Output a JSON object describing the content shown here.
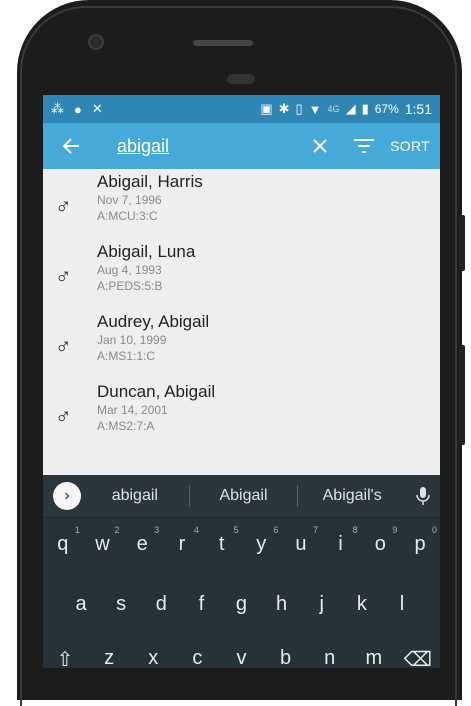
{
  "statusbar": {
    "battery": "67%",
    "time": "1:51",
    "network": "4G"
  },
  "toolbar": {
    "query": "abigail",
    "sort_label": "SORT"
  },
  "patients": [
    {
      "name": "Abigail, Harris",
      "dob": "Nov 7, 1996",
      "location": "A:MCU:3:C",
      "gender_icon": "♂"
    },
    {
      "name": "Abigail, Luna",
      "dob": "Aug 4, 1993",
      "location": "A:PEDS:5:B",
      "gender_icon": "♂"
    },
    {
      "name": "Audrey, Abigail",
      "dob": "Jan 10, 1999",
      "location": "A:MS1:1:C",
      "gender_icon": "♂"
    },
    {
      "name": "Duncan, Abigail",
      "dob": "Mar 14, 2001",
      "location": "A:MS2:7:A",
      "gender_icon": "♂"
    }
  ],
  "keyboard": {
    "suggestions": [
      "abigail",
      "Abigail",
      "Abigail's"
    ],
    "row1": [
      "q",
      "w",
      "e",
      "r",
      "t",
      "y",
      "u",
      "i",
      "o",
      "p"
    ],
    "row1_nums": [
      "1",
      "2",
      "3",
      "4",
      "5",
      "6",
      "7",
      "8",
      "9",
      "0"
    ],
    "row2": [
      "a",
      "s",
      "d",
      "f",
      "g",
      "h",
      "j",
      "k",
      "l"
    ],
    "row3": [
      "z",
      "x",
      "c",
      "v",
      "b",
      "n",
      "m"
    ]
  },
  "colors": {
    "toolbar": "#45a9d9",
    "statusbar": "#2e86b5",
    "keyboard": "#263238"
  }
}
